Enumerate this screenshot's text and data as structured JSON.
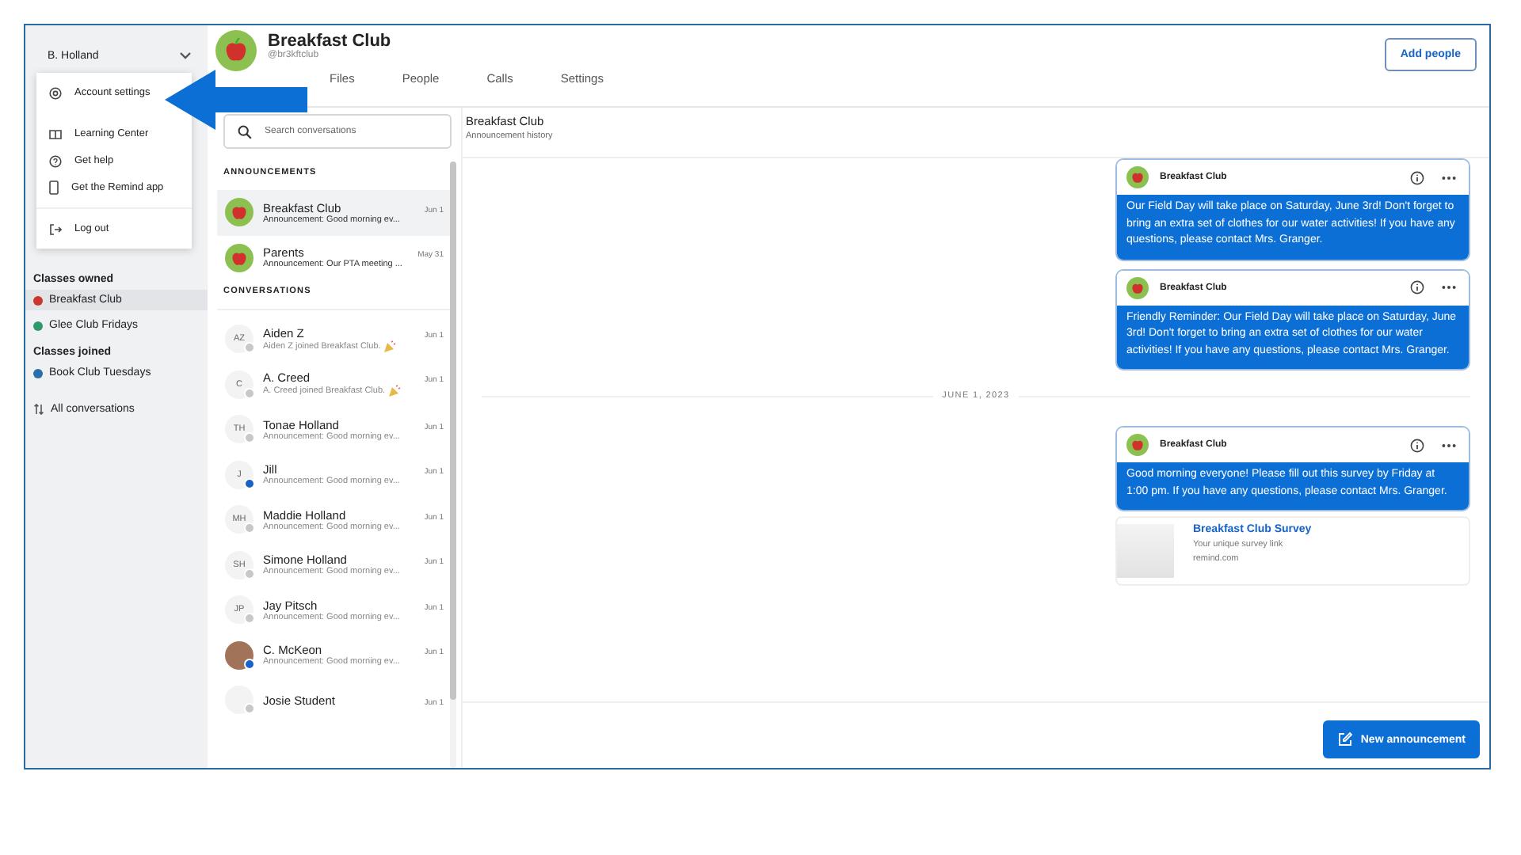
{
  "sidebar": {
    "user": "B. Holland",
    "menu": [
      {
        "label": "Account settings",
        "kind": "gear"
      },
      {
        "label": "Learning Center",
        "kind": "book"
      },
      {
        "label": "Get help",
        "kind": "help"
      },
      {
        "label": "Get the Remind app",
        "kind": "phone"
      },
      {
        "label": "Log out",
        "kind": "logout"
      }
    ],
    "sections": [
      {
        "title": "Classes owned",
        "items": [
          {
            "label": "Breakfast Club",
            "color": "#c8382e",
            "selected": true
          },
          {
            "label": "Glee Club Fridays",
            "color": "#2e9a6a",
            "selected": false
          }
        ]
      },
      {
        "title": "Classes joined",
        "items": [
          {
            "label": "Book Club Tuesdays",
            "color": "#2b6fa8",
            "selected": false
          }
        ]
      }
    ],
    "all_conversations": "All conversations"
  },
  "header": {
    "title": "Breakfast Club",
    "handle": "@br3kftclub",
    "add_button": "Add people"
  },
  "tabs": [
    {
      "label": "Files",
      "selected": false
    },
    {
      "label": "People",
      "selected": false
    },
    {
      "label": "Calls",
      "selected": false
    },
    {
      "label": "Settings",
      "selected": false
    }
  ],
  "search": {
    "placeholder": "Search conversations"
  },
  "announcements": {
    "title": "ANNOUNCEMENTS",
    "items": [
      {
        "name": "Breakfast Club",
        "date": "Jun 1",
        "preview": "Announcement: Good morning ev...",
        "selected": true
      },
      {
        "name": "Parents",
        "date": "May 31",
        "preview": "Announcement: Our PTA meeting ...",
        "selected": false
      }
    ]
  },
  "conversations": {
    "title": "CONVERSATIONS",
    "items": [
      {
        "kind": "initials",
        "initials": "AZ",
        "name": "Aiden Z",
        "date": "Jun 1",
        "preview": "Aiden Z joined Breakfast Club.",
        "party": true,
        "unread": false
      },
      {
        "kind": "initials",
        "initials": "C",
        "name": "A. Creed",
        "date": "Jun 1",
        "preview": "A. Creed joined Breakfast Club.",
        "party": true,
        "unread": false
      },
      {
        "kind": "initials",
        "initials": "TH",
        "name": "Tonae Holland",
        "date": "Jun 1",
        "preview": "Announcement: Good morning ev...",
        "party": false,
        "unread": false
      },
      {
        "kind": "initials",
        "initials": "J",
        "name": "Jill",
        "date": "Jun 1",
        "preview": "Announcement: Good morning ev...",
        "party": false,
        "unread": true
      },
      {
        "kind": "initials",
        "initials": "MH",
        "name": "Maddie Holland",
        "date": "Jun 1",
        "preview": "Announcement: Good morning ev...",
        "party": false,
        "unread": false
      },
      {
        "kind": "initials",
        "initials": "SH",
        "name": "Simone Holland",
        "date": "Jun 1",
        "preview": "Announcement: Good morning ev...",
        "party": false,
        "unread": false
      },
      {
        "kind": "initials",
        "initials": "JP",
        "name": "Jay Pitsch",
        "date": "Jun 1",
        "preview": "Announcement: Good morning ev...",
        "party": false,
        "unread": false
      },
      {
        "kind": "photo",
        "name": "C. McKeon",
        "date": "Jun 1",
        "preview": "Announcement: Good morning ev...",
        "party": false,
        "unread": true
      },
      {
        "kind": "blank",
        "name": "Josie Student",
        "date": "Jun 1",
        "party": false,
        "unread": false
      }
    ]
  },
  "thread": {
    "title": "Breakfast Club",
    "subtitle": "Announcement history",
    "messages": [
      {
        "kind": "message",
        "sender": "Breakfast Club",
        "text": "Our Field Day will take place on Saturday, June 3rd! Don't forget to bring an extra set of clothes for our water activities! If you have any questions, please contact Mrs. Granger."
      },
      {
        "kind": "message",
        "sender": "Breakfast Club",
        "text": "Friendly Reminder: Our Field Day will take place on Saturday, June 3rd! Don't forget to bring an extra set of clothes for our water activities! If you have any questions, please contact Mrs. Granger."
      },
      {
        "kind": "date",
        "text": "JUNE 1, 2023"
      },
      {
        "kind": "message",
        "sender": "Breakfast Club",
        "text": "Good morning everyone! Please fill out this survey by Friday at 1:00 pm. If you have any questions, please contact Mrs. Granger.",
        "link": {
          "title": "Breakfast Club Survey",
          "subtitle": "Your unique survey link",
          "domain": "remind.com"
        }
      }
    ],
    "new_button": "New announcement"
  }
}
